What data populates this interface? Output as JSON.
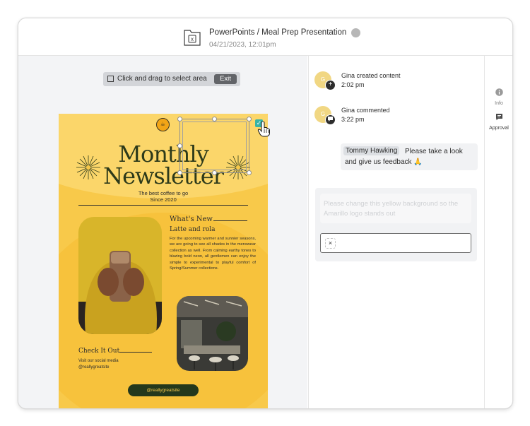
{
  "header": {
    "file_title": "PowerPoints / Meal Prep Presentation",
    "file_date": "04/21/2023, 12:01pm",
    "file_icon_letter": "x",
    "file_icon": "file-x-icon",
    "status_color": "#b7b7b7"
  },
  "canvas": {
    "select_label": "Click and drag to select area",
    "exit_label": "Exit",
    "select_icon": "crop-icon"
  },
  "poster": {
    "background": "#f8c94a",
    "title_line_1": "Monthly",
    "title_line_2": "Newsletter",
    "tagline_1": "The best coffee to go",
    "tagline_2": "Since 2020",
    "section_heading": "What's New",
    "sub_heading": "Latte and rola",
    "body": "For the upcoming warmer and sunnier seasons, we are going to see all shades in the menswear collection as well. From calming earthy tones to blazing bold neon, all gentlemen can enjoy the simple to experimental to playful comfort of Spring/Summer collections.",
    "checkit_heading": "Check It Out",
    "checkit_line_1": "Visit our social media",
    "checkit_line_2": "@reallygreatsite",
    "site_pill": "@reallygreatsite"
  },
  "activity": [
    {
      "name": "Gina created content",
      "time": "2:02 pm",
      "avatar_text": "G",
      "badge_icon": "plus-icon"
    },
    {
      "name": "Gina commented",
      "time": "3:22 pm",
      "avatar_text": "G",
      "badge_icon": "comment-icon"
    }
  ],
  "comment": {
    "mention": "Tommy Hawking",
    "text_1": "Please take a look",
    "text_2": "and give us feedback 🙏"
  },
  "reply": {
    "placeholder": "Please change this yellow background so the Amarillo logo stands out",
    "remove_label": "×"
  },
  "rail": {
    "items": [
      {
        "label": "Info",
        "icon": "info-icon"
      },
      {
        "label": "Approval",
        "icon": "approval-icon"
      }
    ]
  }
}
